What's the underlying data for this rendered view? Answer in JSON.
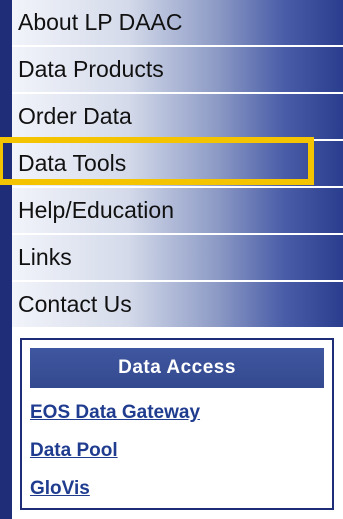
{
  "nav": {
    "items": [
      {
        "label": "About LP DAAC"
      },
      {
        "label": "Data Products"
      },
      {
        "label": "Order Data"
      },
      {
        "label": "Data Tools"
      },
      {
        "label": "Help/Education"
      },
      {
        "label": "Links"
      },
      {
        "label": "Contact Us"
      }
    ],
    "highlighted": "Data Tools"
  },
  "data_access": {
    "title": "Data Access",
    "links": [
      {
        "label": "EOS Data Gateway"
      },
      {
        "label": "Data Pool"
      },
      {
        "label": "GloVis"
      }
    ]
  },
  "colors": {
    "border": "#1f2c78",
    "highlight": "#f5c400",
    "link": "#1f3c8f"
  }
}
